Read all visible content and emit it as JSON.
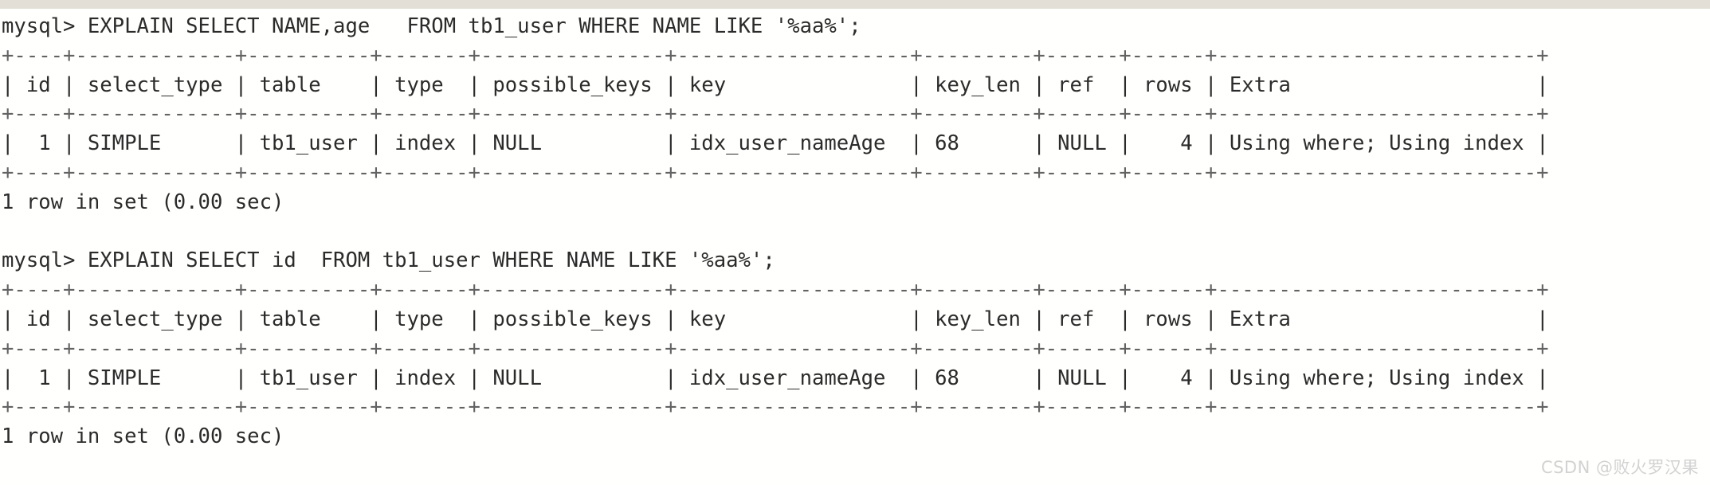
{
  "window": {
    "background_color": "#fffffd",
    "top_band_color": "#e3dfd7",
    "text_color": "#2b2b2b"
  },
  "watermark": {
    "text": "CSDN @败火罗汉果",
    "color": "#d2d2d2"
  },
  "terminal": {
    "prompt": "mysql>",
    "blocks": [
      {
        "command_line": "mysql> EXPLAIN SELECT NAME,age   FROM tb1_user WHERE NAME LIKE '%aa%';",
        "query": "EXPLAIN SELECT NAME,age   FROM tb1_user WHERE NAME LIKE '%aa%';",
        "top_rule": "+----+-------------+----------+-------+---------------+-------------------+---------+------+------+--------------------------+",
        "header_line": "| id | select_type | table    | type  | possible_keys | key               | key_len | ref  | rows | Extra                    |",
        "mid_rule": "+----+-------------+----------+-------+---------------+-------------------+---------+------+------+--------------------------+",
        "data_line": "|  1 | SIMPLE      | tb1_user | index | NULL          | idx_user_nameAge  | 68      | NULL |    4 | Using where; Using index |",
        "bottom_rule": "+----+-------------+----------+-------+---------------+-------------------+---------+------+------+--------------------------+",
        "status_line": "1 row in set (0.00 sec)",
        "columns": [
          "id",
          "select_type",
          "table",
          "type",
          "possible_keys",
          "key",
          "key_len",
          "ref",
          "rows",
          "Extra"
        ],
        "rows": [
          [
            "1",
            "SIMPLE",
            "tb1_user",
            "index",
            "NULL",
            "idx_user_nameAge",
            "68",
            "NULL",
            "4",
            "Using where; Using index"
          ]
        ],
        "row_count": "1 row in set",
        "elapsed": "(0.00 sec)"
      },
      {
        "command_line": "mysql> EXPLAIN SELECT id  FROM tb1_user WHERE NAME LIKE '%aa%';",
        "query": "EXPLAIN SELECT id  FROM tb1_user WHERE NAME LIKE '%aa%';",
        "top_rule": "+----+-------------+----------+-------+---------------+-------------------+---------+------+------+--------------------------+",
        "header_line": "| id | select_type | table    | type  | possible_keys | key               | key_len | ref  | rows | Extra                    |",
        "mid_rule": "+----+-------------+----------+-------+---------------+-------------------+---------+------+------+--------------------------+",
        "data_line": "|  1 | SIMPLE      | tb1_user | index | NULL          | idx_user_nameAge  | 68      | NULL |    4 | Using where; Using index |",
        "bottom_rule": "+----+-------------+----------+-------+---------------+-------------------+---------+------+------+--------------------------+",
        "status_line": "1 row in set (0.00 sec)",
        "columns": [
          "id",
          "select_type",
          "table",
          "type",
          "possible_keys",
          "key",
          "key_len",
          "ref",
          "rows",
          "Extra"
        ],
        "rows": [
          [
            "1",
            "SIMPLE",
            "tb1_user",
            "index",
            "NULL",
            "idx_user_nameAge",
            "68",
            "NULL",
            "4",
            "Using where; Using index"
          ]
        ],
        "row_count": "1 row in set",
        "elapsed": "(0.00 sec)"
      }
    ],
    "spacer": " "
  }
}
